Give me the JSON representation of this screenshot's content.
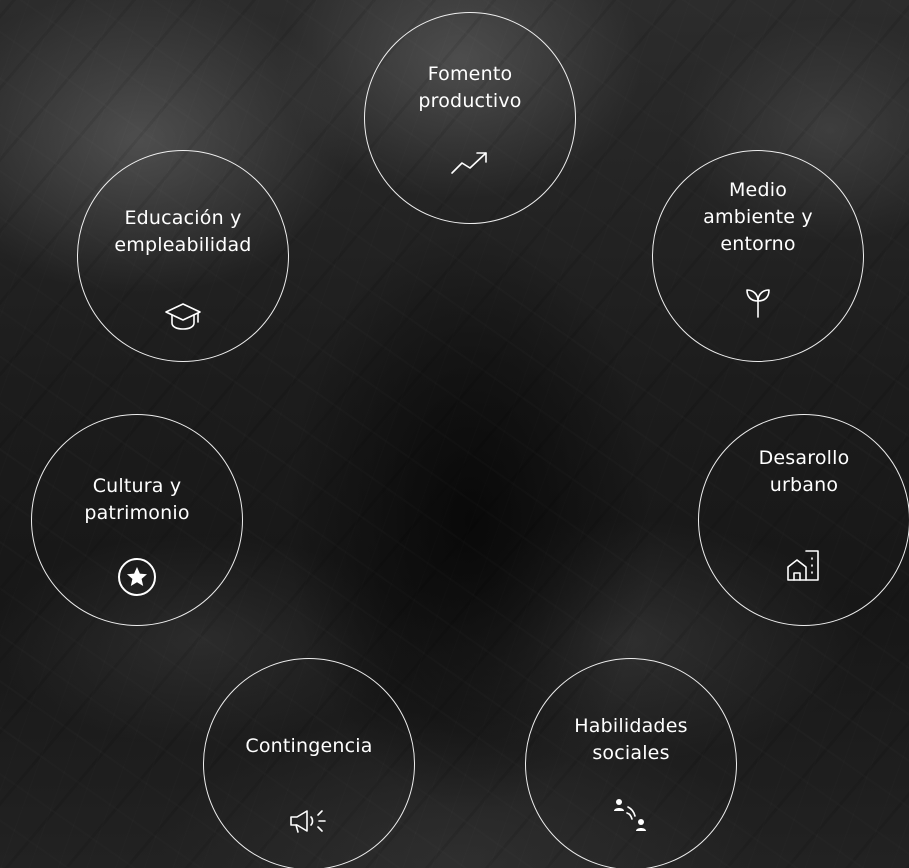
{
  "background": {
    "description_color": "#1a1a1a"
  },
  "areas": {
    "fomento": {
      "label": "Fomento\nproductivo",
      "icon": "trending-up-icon"
    },
    "educacion": {
      "label": "Educación y\nempleabilidad",
      "icon": "graduation-cap-icon"
    },
    "medio": {
      "label": "Medio\nambiente y\nentorno",
      "icon": "sprout-icon"
    },
    "cultura": {
      "label": "Cultura y\npatrimonio",
      "icon": "star-circle-icon"
    },
    "desarrollo": {
      "label": "Desarollo\nurbano",
      "icon": "house-building-icon"
    },
    "contingencia": {
      "label": "Contingencia",
      "icon": "megaphone-icon"
    },
    "habilidades": {
      "label": "Habilidades\nsociales",
      "icon": "people-talking-icon"
    }
  },
  "colors": {
    "ring": "#ffffff",
    "text": "#ffffff"
  }
}
